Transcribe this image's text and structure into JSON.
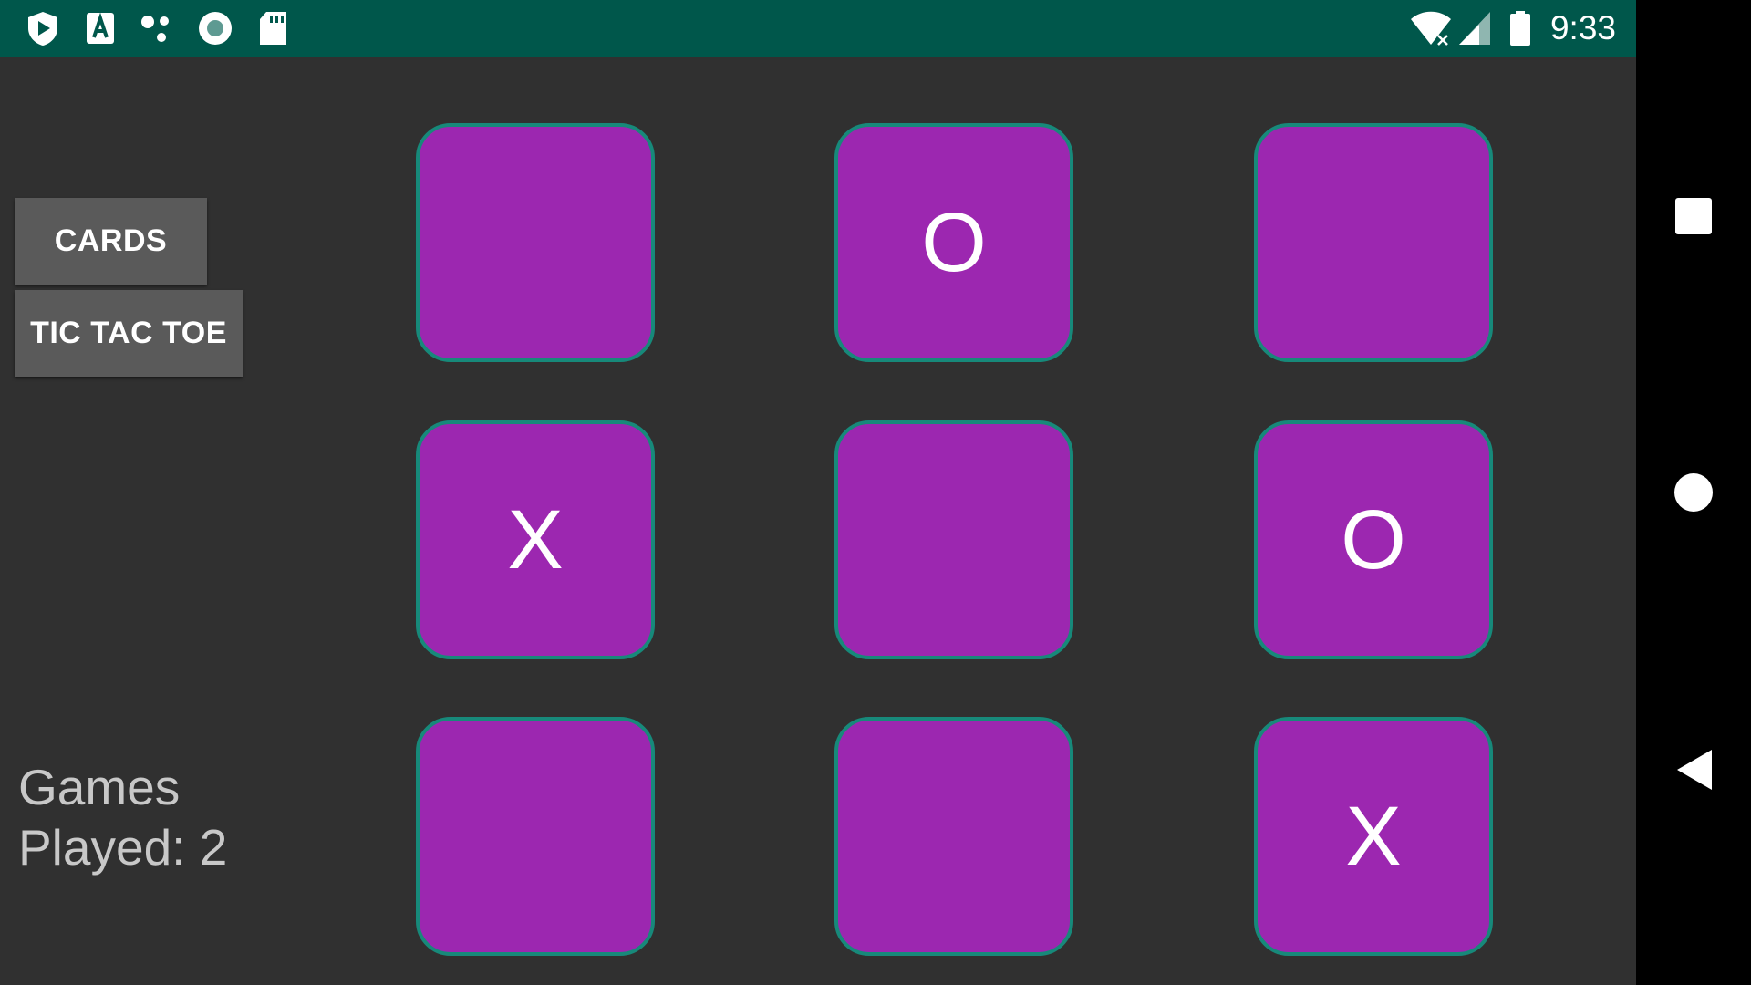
{
  "status_bar": {
    "time": "9:33",
    "icons_left": [
      "play-protect-icon",
      "text-a-icon",
      "dots-icon",
      "record-icon",
      "sd-card-icon"
    ],
    "icons_right": [
      "wifi-icon",
      "cell-signal-icon",
      "battery-icon"
    ],
    "color": "#00574b"
  },
  "sidebar": {
    "cards_label": "CARDS",
    "tictactoe_label": "TIC TAC TOE"
  },
  "stats": {
    "games_line1": "Games",
    "games_line2": "Played: 2"
  },
  "board": {
    "cells": [
      "",
      "O",
      "",
      "X",
      "",
      "O",
      "",
      "",
      "X"
    ],
    "cell_color": "#9c27b0",
    "border_color": "#17897a"
  },
  "nav": {
    "buttons": [
      "recents-icon",
      "home-icon",
      "back-icon"
    ]
  }
}
